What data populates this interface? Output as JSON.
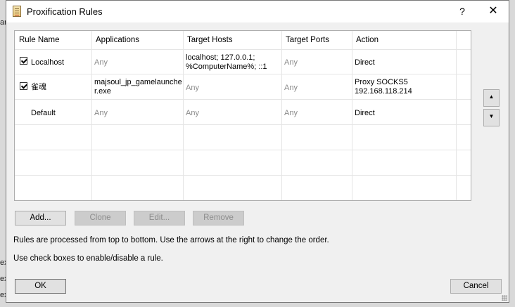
{
  "window": {
    "title": "Proxification Rules",
    "help_label": "?",
    "close_label": "✕"
  },
  "background_fragments": [
    "ar",
    "ex",
    "ex",
    "ex"
  ],
  "table": {
    "columns": [
      "Rule Name",
      "Applications",
      "Target Hosts",
      "Target Ports",
      "Action"
    ],
    "rows": [
      {
        "checked": true,
        "name": "Localhost",
        "applications": "Any",
        "hosts_line1": "localhost; 127.0.0.1;",
        "hosts_line2": "%ComputerName%; ::1",
        "ports": "Any",
        "action_line1": "Direct",
        "action_line2": ""
      },
      {
        "checked": true,
        "name": "雀魂",
        "applications_line1": "majsoul_jp_gamelaunche",
        "applications_line2": "r.exe",
        "hosts": "Any",
        "ports": "Any",
        "action_line1": "Proxy SOCKS5",
        "action_line2": "192.168.118.214"
      },
      {
        "checked": false,
        "name": "Default",
        "applications": "Any",
        "hosts": "Any",
        "ports": "Any",
        "action_line1": "Direct",
        "action_line2": ""
      }
    ]
  },
  "buttons": {
    "add": "Add...",
    "clone": "Clone",
    "edit": "Edit...",
    "remove": "Remove",
    "ok": "OK",
    "cancel": "Cancel",
    "move_up": "▲",
    "move_down": "▼"
  },
  "info": {
    "line1": "Rules are processed from top to bottom. Use the arrows at the right to change the order.",
    "line2": "Use check boxes to enable/disable a rule."
  },
  "icons": [
    "rules-doc-icon",
    "checkbox-checked-icon",
    "arrow-up-icon",
    "arrow-down-icon",
    "resize-grip-icon"
  ]
}
